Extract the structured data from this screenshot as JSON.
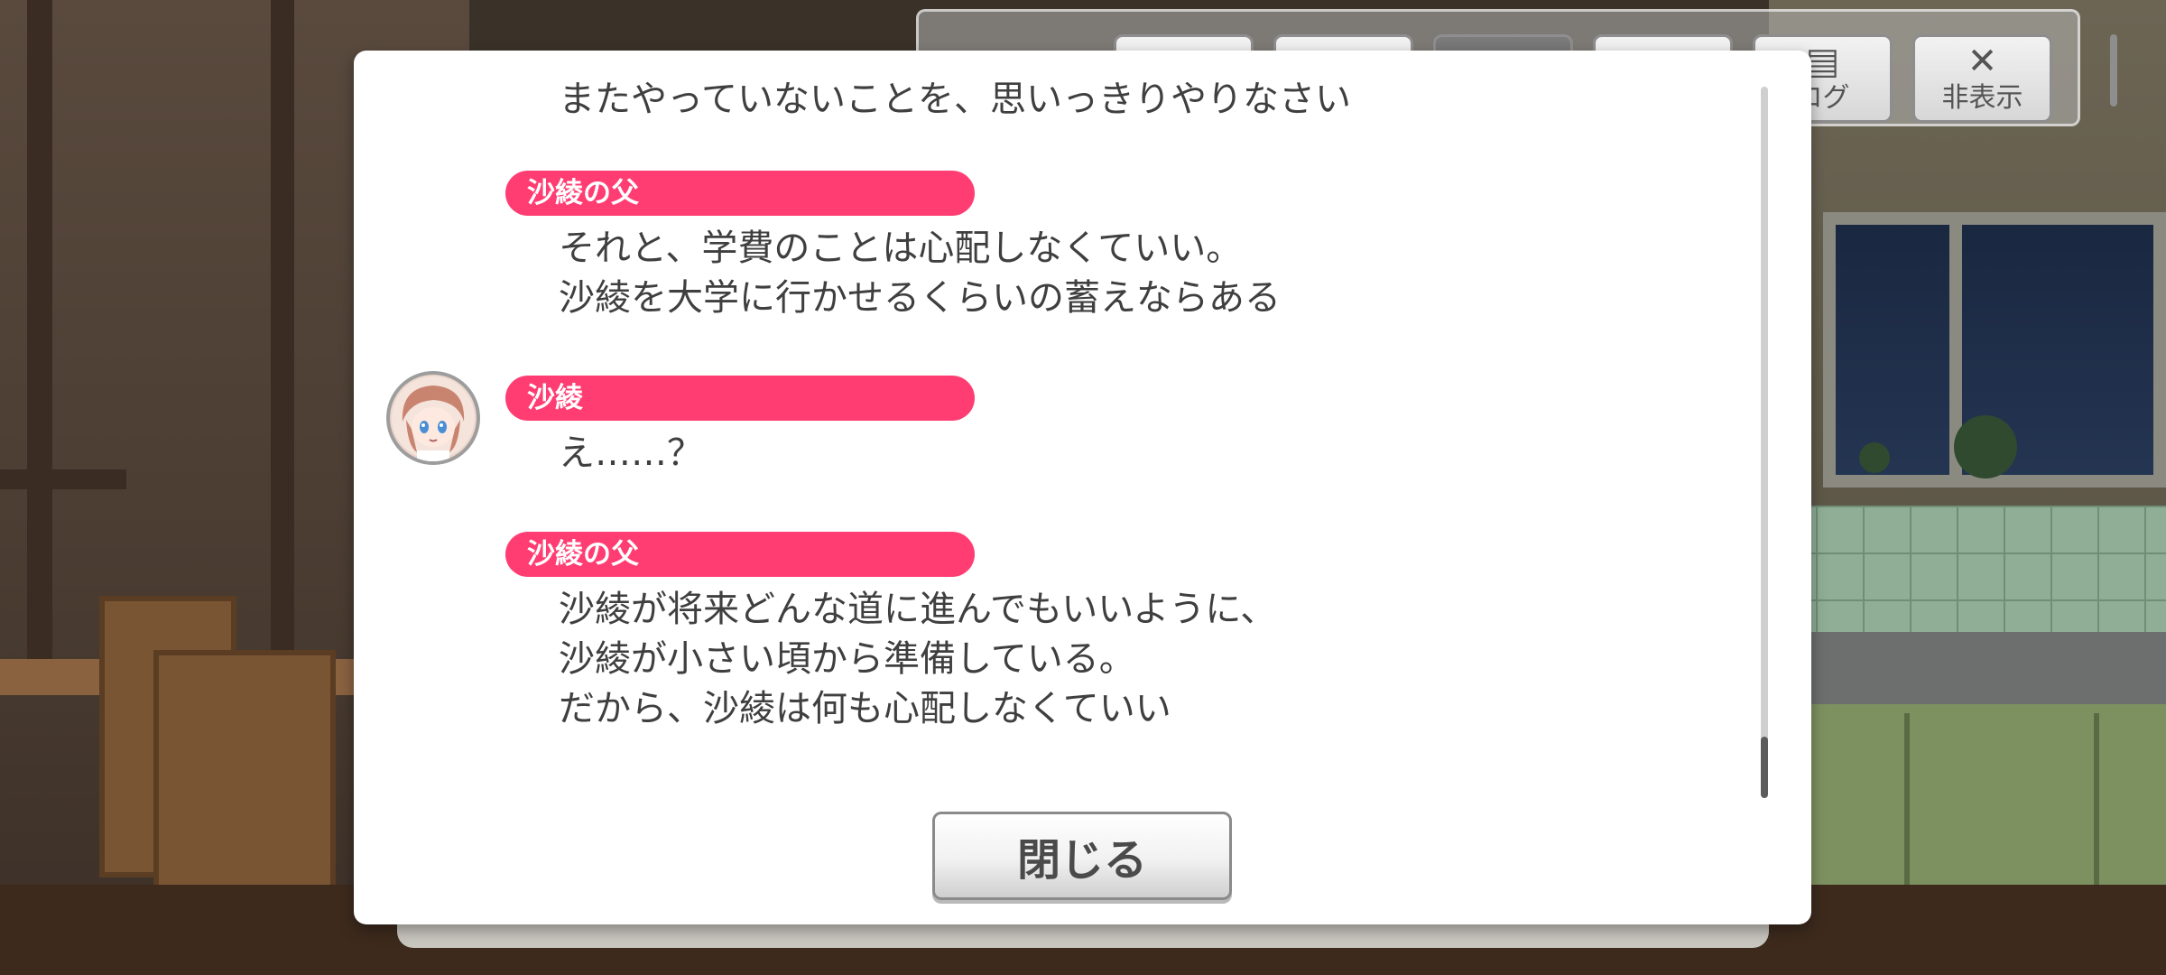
{
  "toolbar": {
    "buttons": [
      {
        "icon": "fast-forward-icon",
        "glyph": "⏭",
        "label": ""
      },
      {
        "icon": "play-icon",
        "glyph": "▶",
        "label": ""
      },
      {
        "icon": "auto-icon",
        "glyph": "[▶]",
        "label": ""
      },
      {
        "icon": "skip-icon",
        "glyph": "⏩",
        "label": ""
      },
      {
        "icon": "log-icon",
        "glyph": "▤",
        "label": "ログ"
      },
      {
        "icon": "hide-icon",
        "glyph": "✕",
        "label": "非表示"
      }
    ]
  },
  "log": {
    "cut_line": "またやっていないことを、思いっきりやりなさい",
    "entries": [
      {
        "speaker": "沙綾の父",
        "has_avatar": false,
        "lines": [
          "それと、学費のことは心配しなくていい。",
          "沙綾を大学に行かせるくらいの蓄えならある"
        ]
      },
      {
        "speaker": "沙綾",
        "has_avatar": true,
        "lines": [
          "え……？"
        ]
      },
      {
        "speaker": "沙綾の父",
        "has_avatar": false,
        "lines": [
          "沙綾が将来どんな道に進んでもいいように、",
          "沙綾が小さい頃から準備している。",
          "だから、沙綾は何も心配しなくていい"
        ]
      }
    ]
  },
  "close_label": "閉じる",
  "colors": {
    "name_pill": "#ff3d72",
    "panel": "#ffffff",
    "text": "#3f3f3f"
  }
}
